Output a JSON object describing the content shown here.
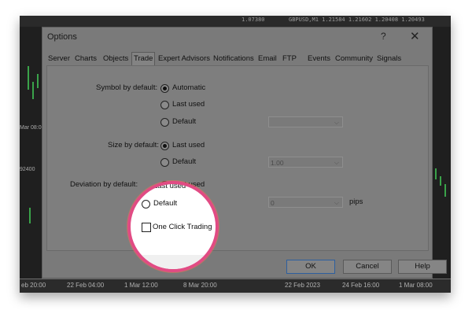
{
  "background": {
    "top_prices": [
      "1.07380",
      "GBPUSD,M1 1.21584 1.21602 1.20408 1.20493"
    ],
    "left_labels": [
      "Mar 08:00",
      "92400"
    ],
    "axis_dates": [
      "eb 20:00",
      "22 Feb 04:00",
      "1 Mar 12:00",
      "8 Mar 20:00",
      "22 Feb 2023",
      "24 Feb 16:00",
      "1 Mar 08:00"
    ]
  },
  "dialog": {
    "title": "Options",
    "help_label": "?",
    "close_label": "✕",
    "tabs": [
      "Server",
      "Charts",
      "Objects",
      "Trade",
      "Expert Advisors",
      "Notifications",
      "Email",
      "FTP",
      "Events",
      "Community",
      "Signals"
    ],
    "active_tab": "Trade",
    "symbol": {
      "label": "Symbol by default:",
      "options": [
        "Automatic",
        "Last used",
        "Default"
      ],
      "selected": "Automatic",
      "combo_value": ""
    },
    "size": {
      "label": "Size by default:",
      "options": [
        "Last used",
        "Default"
      ],
      "selected": "Last used",
      "combo_value": "1.00"
    },
    "deviation": {
      "label": "Deviation by default:",
      "options": [
        "Last used",
        "Default"
      ],
      "selected": "Last used",
      "combo_value": "0",
      "unit": "pips"
    },
    "one_click": {
      "label": "One Click Trading",
      "checked": false
    },
    "buttons": {
      "ok": "OK",
      "cancel": "Cancel",
      "help": "Help"
    }
  },
  "colors": {
    "magnifier_ring": "#e14b84",
    "overlay": "#6f6f6f"
  }
}
